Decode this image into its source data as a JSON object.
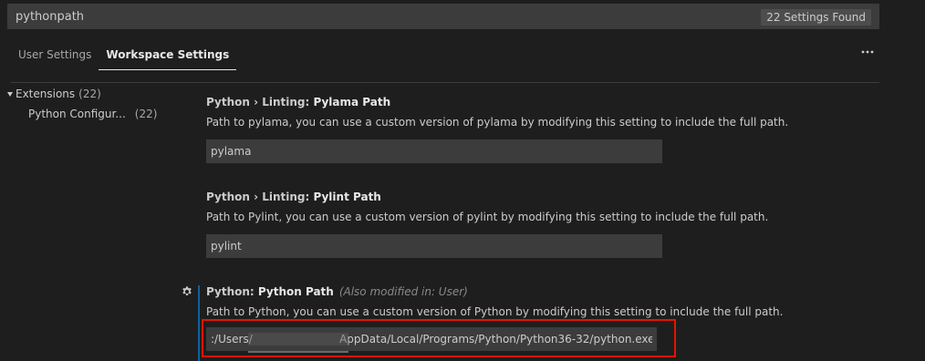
{
  "search": {
    "value": "pythonpath",
    "results_badge": "22 Settings Found"
  },
  "tabs": [
    {
      "label": "User Settings",
      "active": false
    },
    {
      "label": "Workspace Settings",
      "active": true
    }
  ],
  "more_actions_icon": "ellipsis-icon",
  "toc": {
    "extensions": {
      "label": "Extensions",
      "count": "(22)"
    },
    "python_configuration": {
      "label": "Python Configur...",
      "count": "(22)"
    }
  },
  "settings": [
    {
      "category": "Python › Linting: ",
      "label": "Pylama Path",
      "description": "Path to pylama, you can use a custom version of pylama by modifying this setting to include the full path.",
      "value": "pylama"
    },
    {
      "category": "Python › Linting: ",
      "label": "Pylint Path",
      "description": "Path to Pylint, you can use a custom version of pylint by modifying this setting to include the full path.",
      "value": "pylint"
    },
    {
      "category": "Python: ",
      "label": "Python Path",
      "modified_note": "(Also modified in: User)",
      "description": "Path to Python, you can use a custom version of Python by modifying this setting to include the full path.",
      "value": ":/Users/                         AppData/Local/Programs/Python/Python36-32/python.exe"
    }
  ],
  "colors": {
    "background": "#1e1e1e",
    "input_background": "#3c3c3c",
    "highlight_border": "#e51400",
    "modified_indicator": "#0e639c"
  }
}
